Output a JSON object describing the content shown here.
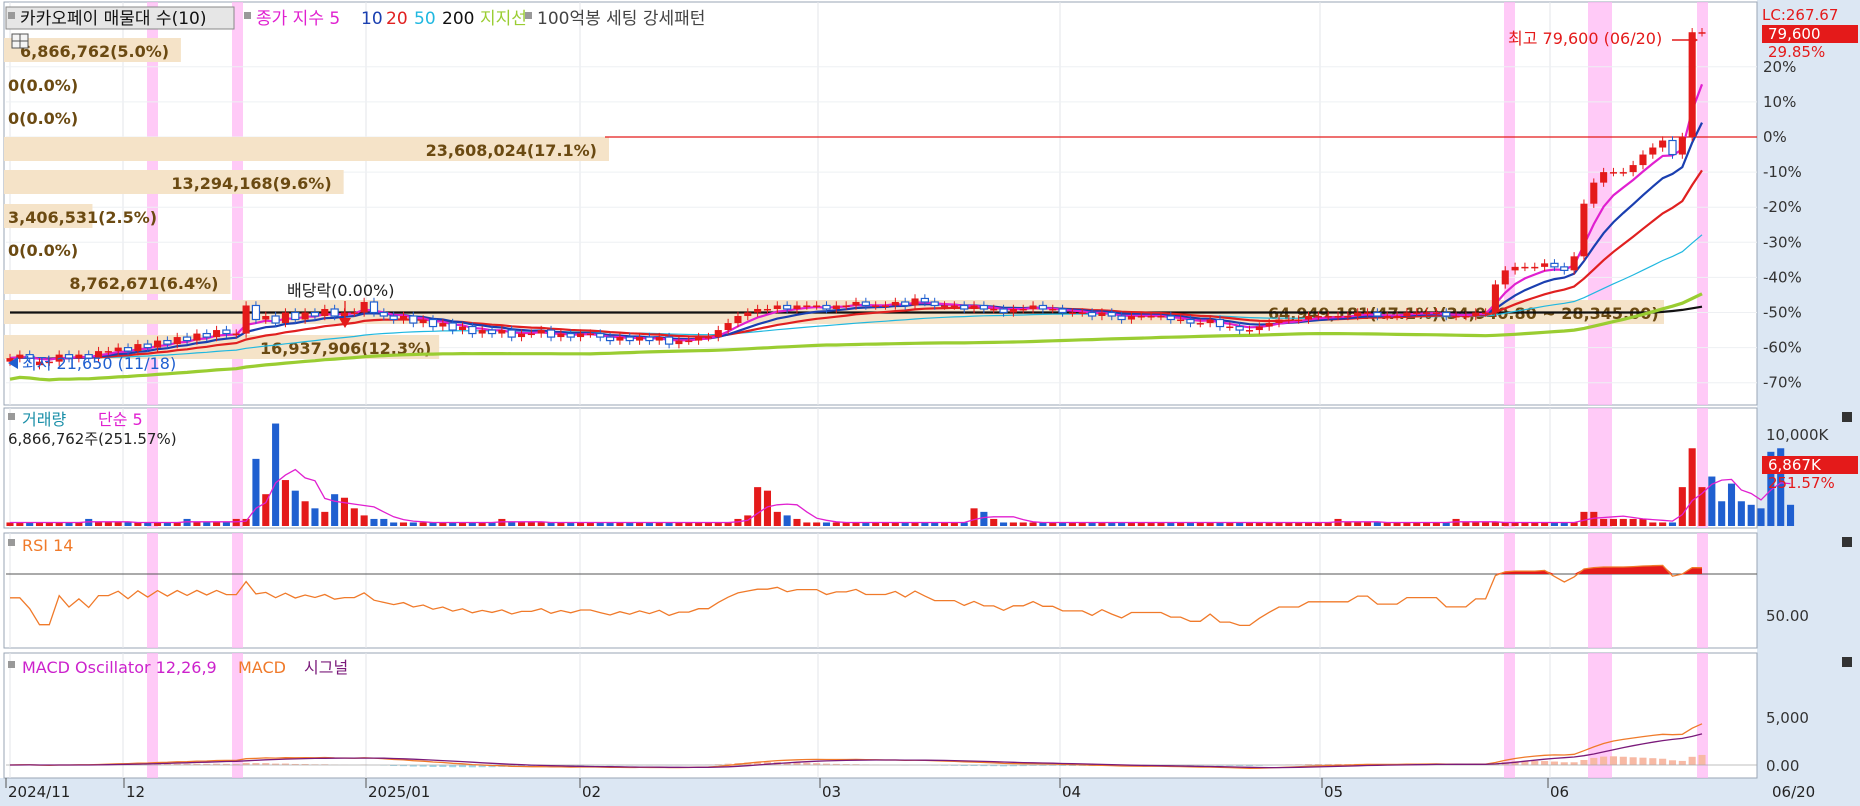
{
  "header": {
    "stock_name": "카카오페이 매물대 수(10)",
    "legend": [
      {
        "text": "종가 지수 5",
        "color": "#e020d0"
      },
      {
        "text": "10",
        "color": "#1a3fb0"
      },
      {
        "text": "20",
        "color": "#e02020"
      },
      {
        "text": "50",
        "color": "#20b8e0"
      },
      {
        "text": "200",
        "color": "#111111"
      },
      {
        "text": "지지선",
        "color": "#9acd32"
      },
      {
        "text": "100억봉 세팅 강세패턴",
        "color": "#444444"
      }
    ]
  },
  "volume_profile": [
    {
      "label": "6,866,762(5.0%)",
      "pct": 5.0
    },
    {
      "label": "0(0.0%)",
      "pct": 0.0
    },
    {
      "label": "0(0.0%)",
      "pct": 0.0
    },
    {
      "label": "23,608,024(17.1%)",
      "pct": 17.1
    },
    {
      "label": "13,294,168(9.6%)",
      "pct": 9.6
    },
    {
      "label": "3,406,531(2.5%)",
      "pct": 2.5
    },
    {
      "label": "0(0.0%)",
      "pct": 0.0
    },
    {
      "label": "8,762,671(6.4%)",
      "pct": 6.4
    },
    {
      "label": "64,949,181(47.1%)(34,940.80 ~ 28,345.00)",
      "pct": 47.1
    },
    {
      "label": "16,937,906(12.3%)",
      "pct": 12.3
    }
  ],
  "annotations": {
    "high": "최고 79,600 (06/20)",
    "low": "최저 21,650 (11/18)",
    "dividend": "배당락(0.00%)",
    "lc": "LC:267.67",
    "price_badge": "79,600",
    "pct_badge": "29.85%"
  },
  "price_axis": {
    "ticks": [
      "20%",
      "10%",
      "0%",
      "-10%",
      "-20%",
      "-30%",
      "-40%",
      "-50%",
      "-60%",
      "-70%"
    ],
    "values": [
      20,
      10,
      0,
      -10,
      -20,
      -30,
      -40,
      -50,
      -60,
      -70
    ]
  },
  "x_axis": {
    "ticks": [
      "2024/11",
      "12",
      "2025/01",
      "02",
      "03",
      "04",
      "05",
      "06"
    ],
    "last_date": "06/20"
  },
  "volume_panel": {
    "title": "거래량",
    "ma_label": "단순 5",
    "info": "6,866,762주(251.57%)",
    "axis_label": "10,000K",
    "badge_value": "6,867K",
    "badge_pct": "251.57%"
  },
  "rsi_panel": {
    "title": "RSI 14",
    "axis_label": "50.00"
  },
  "macd_panel": {
    "title": "MACD Oscillator 12,26,9",
    "macd_label": "MACD",
    "signal_label": "시그널",
    "axis_labels": [
      "5,000",
      "0.00"
    ]
  },
  "colors": {
    "up": "#e41a1a",
    "down": "#1f5fd0",
    "highlight": "#ffb8f4",
    "profile": "#f5e3c8",
    "profile_text": "#6b4a12"
  },
  "chart_data": {
    "type": "candlestick",
    "xlabel": "",
    "ylabel": "",
    "y_unit": "%",
    "ylim": [
      -72,
      30
    ],
    "reference_line": 0,
    "candles": [
      [
        -64,
        -63,
        -62,
        -65,
        -64,
        -64,
        -62,
        -63,
        -62,
        -63,
        -61,
        -61,
        -60,
        -61,
        -59,
        -60,
        -58,
        -59,
        -57,
        -58,
        -56,
        -57,
        -55,
        -56,
        -56,
        -48,
        -52,
        -51,
        -53,
        -50,
        -52,
        -50,
        -51,
        -49,
        -51,
        -50,
        -50,
        -47,
        -50,
        -51,
        -52,
        -51,
        -53,
        -52,
        -54,
        -53,
        -55,
        -54,
        -56,
        -55,
        -56,
        -55,
        -57,
        -56,
        -56,
        -55,
        -57,
        -56,
        -57,
        -56,
        -56,
        -57,
        -58,
        -57,
        -58,
        -57,
        -58,
        -57,
        -59,
        -58,
        -58,
        -57,
        -57,
        -55,
        -53,
        -51,
        -50,
        -49,
        -49,
        -48,
        -49,
        -48,
        -48,
        -48,
        -49,
        -48,
        -48,
        -47,
        -48,
        -48,
        -48,
        -47,
        -48,
        -46,
        -47,
        -48,
        -48,
        -48,
        -49,
        -48,
        -49,
        -49,
        -50,
        -49,
        -49,
        -48,
        -49,
        -49,
        -50,
        -50,
        -50,
        -51,
        -50,
        -51,
        -52,
        -51,
        -51,
        -51,
        -51,
        -52,
        -52,
        -53,
        -53,
        -52,
        -54,
        -54,
        -55,
        -55,
        -54,
        -53,
        -52,
        -52,
        -52,
        -51,
        -51,
        -51,
        -51,
        -51,
        -50,
        -50,
        -51,
        -51,
        -51,
        -50,
        -50,
        -50,
        -50,
        -51,
        -51,
        -51,
        -50,
        -50,
        -42,
        -38,
        -37,
        -37,
        -37,
        -36,
        -37,
        -38,
        -34,
        -19,
        -13,
        -10,
        -10,
        -10,
        -8,
        -5,
        -3,
        -1,
        -5,
        0,
        29.85
      ],
      [
        -63,
        -62,
        -63,
        -64,
        -64,
        -62,
        -63,
        -62,
        -63,
        -61,
        -61,
        -60,
        -61,
        -59,
        -60,
        -58,
        -59,
        -57,
        -58,
        -56,
        -57,
        -55,
        -56,
        -56,
        -48,
        -52,
        -51,
        -53,
        -50,
        -52,
        -50,
        -51,
        -49,
        -51,
        -50,
        -50,
        -47,
        -50,
        -51,
        -52,
        -51,
        -53,
        -52,
        -54,
        -53,
        -55,
        -54,
        -56,
        -55,
        -56,
        -55,
        -57,
        -56,
        -56,
        -55,
        -57,
        -56,
        -57,
        -56,
        -56,
        -57,
        -58,
        -57,
        -58,
        -57,
        -58,
        -57,
        -59,
        -58,
        -58,
        -57,
        -57,
        -55,
        -53,
        -51,
        -50,
        -49,
        -49,
        -48,
        -49,
        -48,
        -48,
        -48,
        -49,
        -48,
        -48,
        -47,
        -48,
        -48,
        -48,
        -47,
        -48,
        -46,
        -47,
        -48,
        -48,
        -48,
        -49,
        -48,
        -49,
        -49,
        -50,
        -49,
        -49,
        -48,
        -49,
        -49,
        -50,
        -50,
        -50,
        -51,
        -50,
        -51,
        -52,
        -51,
        -51,
        -51,
        -51,
        -52,
        -52,
        -53,
        -53,
        -52,
        -54,
        -54,
        -55,
        -55,
        -54,
        -53,
        -52,
        -52,
        -52,
        -51,
        -51,
        -51,
        -51,
        -51,
        -50,
        -50,
        -51,
        -51,
        -51,
        -50,
        -50,
        -50,
        -50,
        -51,
        -51,
        -51,
        -50,
        -50,
        -42,
        -38,
        -37,
        -37,
        -37,
        -36,
        -37,
        -38,
        -34,
        -19,
        -13,
        -10,
        -10,
        -10,
        -8,
        -5,
        -3,
        -1,
        -5,
        0,
        29.85,
        29.85
      ]
    ],
    "volume": [
      1,
      1,
      1,
      1,
      1,
      1,
      1,
      1,
      2,
      1,
      1,
      1,
      1,
      1,
      1,
      1,
      1,
      1,
      2,
      1,
      1,
      1,
      1,
      2,
      2,
      19,
      9,
      29,
      13,
      10,
      7,
      5,
      4,
      9,
      8,
      5,
      3,
      2,
      2,
      1,
      1,
      1,
      1,
      1,
      1,
      1,
      1,
      1,
      1,
      1,
      2,
      1,
      1,
      1,
      1,
      1,
      1,
      1,
      1,
      1,
      1,
      1,
      1,
      1,
      1,
      1,
      1,
      1,
      1,
      1,
      1,
      1,
      1,
      1,
      2,
      3,
      11,
      10,
      4,
      3,
      2,
      1,
      1,
      1,
      1,
      1,
      1,
      1,
      1,
      1,
      1,
      1,
      1,
      1,
      1,
      1,
      1,
      1,
      5,
      4,
      2,
      1,
      1,
      1,
      1,
      1,
      1,
      1,
      1,
      1,
      1,
      1,
      1,
      1,
      1,
      1,
      1,
      1,
      1,
      1,
      1,
      1,
      1,
      1,
      1,
      1,
      1,
      1,
      1,
      1,
      1,
      1,
      1,
      1,
      1,
      2,
      1,
      1,
      1,
      1,
      1,
      1,
      1,
      1,
      1,
      1,
      1,
      2,
      1,
      1,
      1,
      1,
      1,
      1,
      1,
      1,
      1,
      1,
      1,
      1,
      4,
      4,
      2,
      2,
      2,
      2,
      2,
      1,
      1,
      1,
      11,
      22,
      11,
      14,
      7,
      12,
      7,
      6,
      5,
      21,
      22,
      6
    ]
  }
}
